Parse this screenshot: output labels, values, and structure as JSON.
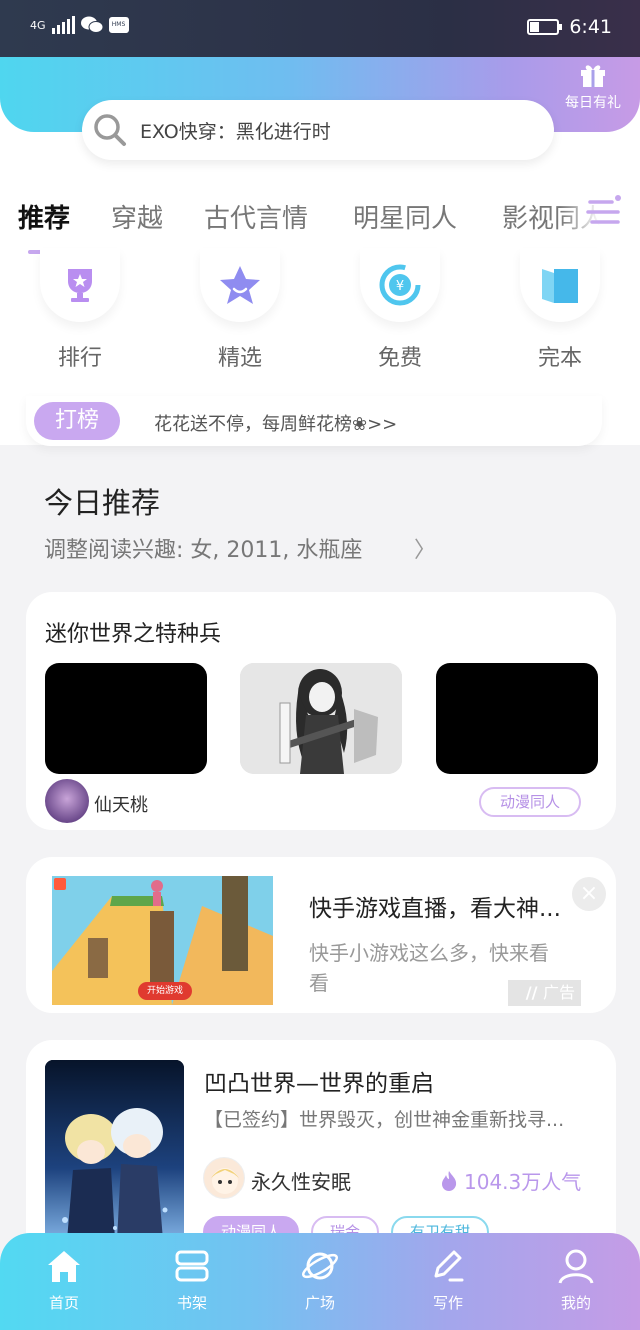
{
  "status_bar": {
    "network": "4G",
    "time": "6:41"
  },
  "header": {
    "search_placeholder": "EXO快穿：黑化进行时",
    "gift_label": "每日有礼"
  },
  "tabs": [
    "推荐",
    "穿越",
    "古代言情",
    "明星同人",
    "影视同人"
  ],
  "active_tab": "推荐",
  "categories": [
    {
      "label": "排行",
      "icon": "trophy-icon"
    },
    {
      "label": "精选",
      "icon": "star-icon"
    },
    {
      "label": "免费",
      "icon": "yuan-cycle-icon"
    },
    {
      "label": "完本",
      "icon": "book-icon"
    }
  ],
  "promo": {
    "badge": "打榜",
    "text": "花花送不停，每周鲜花榜❀>>"
  },
  "today": {
    "title": "今日推荐",
    "subtitle": "调整阅读兴趣: 女, 2011, 水瓶座"
  },
  "card1": {
    "title": "迷你世界之特种兵",
    "author": "仙天桃",
    "tag": "动漫同人"
  },
  "ad": {
    "title": "快手游戏直播，看大神...",
    "desc": "快手小游戏这么多，快来看看",
    "mark": "广告",
    "game_button": "开始游戏",
    "close": "×"
  },
  "book": {
    "title": "凹凸世界—世界的重启",
    "desc": "【已签约】世界毁灭，创世神金重新找寻...",
    "author": "永久性安眠",
    "popularity": "104.3万人气",
    "tags": [
      "动漫同人",
      "瑞金",
      "有卫有甜"
    ]
  },
  "bottom_nav": [
    "首页",
    "书架",
    "广场",
    "写作",
    "我的"
  ],
  "colors": {
    "accent_purple": "#c9a8f0",
    "gradient_start": "#4fd6ef",
    "gradient_end": "#c79be6"
  }
}
